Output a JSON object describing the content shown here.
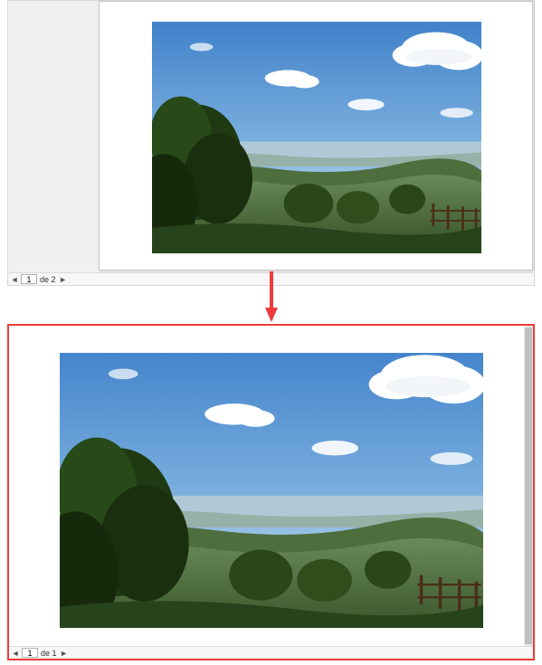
{
  "top": {
    "nav": {
      "prev_icon": "◄",
      "page_value": "1",
      "of_label": "de 2",
      "next_icon": "►"
    }
  },
  "bottom": {
    "nav": {
      "prev_icon": "◄",
      "page_value": "1",
      "of_label": "de 1",
      "next_icon": "►"
    }
  },
  "colors": {
    "highlight_border": "#ee3b3b",
    "arrow": "#ee3b3b"
  }
}
